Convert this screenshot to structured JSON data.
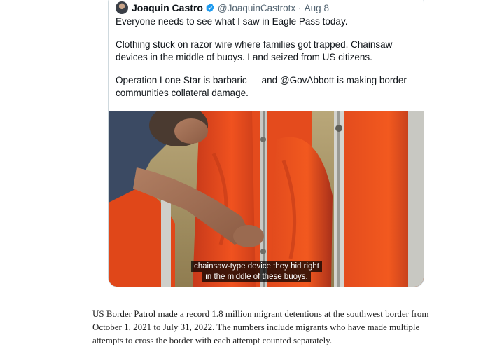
{
  "tweet": {
    "author_name": "Joaquin Castro",
    "handle": "@JoaquinCastrotx",
    "separator": "·",
    "date": "Aug 8",
    "paragraphs": [
      "Everyone needs to see what I saw in Eagle Pass today.",
      "Clothing stuck on razor wire where families got trapped. Chainsaw devices in the middle of buoys. Land seized from US citizens.",
      "Operation Lone Star is barbaric — and @GovAbbott is making border communities collateral damage."
    ],
    "video_caption": {
      "line1": "chainsaw-type device they hid right",
      "line2": "in the middle of these buoys."
    }
  },
  "article": {
    "paragraph": "US Border Patrol made a record 1.8 million migrant detentions at the southwest border from October 1, 2021 to July 31, 2022. The numbers include migrants who have made multiple attempts to cross the border with each attempt counted separately."
  },
  "colors": {
    "verified_badge": "#1d9bf0",
    "buoy_orange": "#e8461c",
    "card_border": "#cfd9de"
  },
  "icons": {
    "verified": "verified-badge-icon",
    "avatar": "author-avatar"
  }
}
